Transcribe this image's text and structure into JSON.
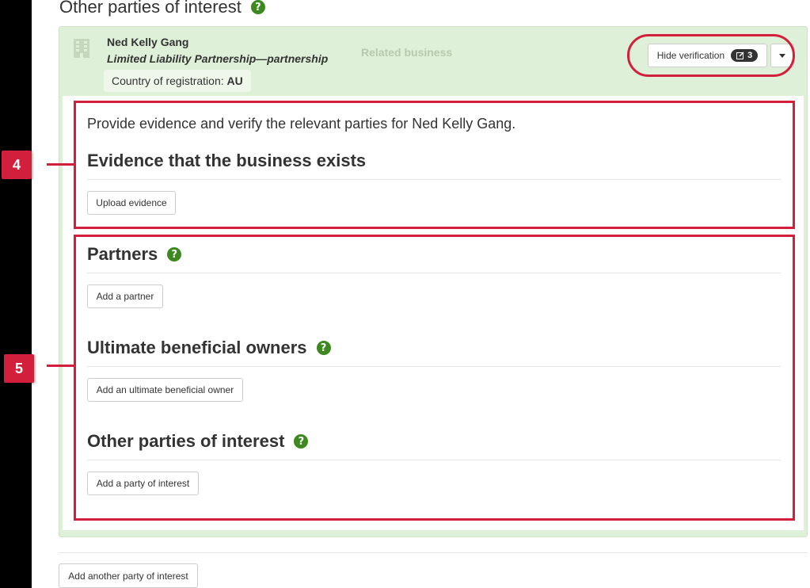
{
  "page": {
    "title": "Other parties of interest",
    "help_glyph": "?"
  },
  "party": {
    "name": "Ned Kelly Gang",
    "type": "Limited Liability Partnership—partnership",
    "country_label": "Country of registration:",
    "country_value": "AU",
    "related_label": "Related business",
    "hide_verification_label": "Hide verification",
    "verification_count": "3"
  },
  "verification": {
    "intro": "Provide evidence and verify the relevant parties for Ned Kelly Gang.",
    "evidence": {
      "title": "Evidence that the business exists",
      "button": "Upload evidence"
    },
    "partners": {
      "title": "Partners",
      "button": "Add a partner"
    },
    "ubo": {
      "title": "Ultimate beneficial owners",
      "button": "Add an ultimate beneficial owner"
    },
    "other": {
      "title": "Other parties of interest",
      "button": "Add a party of interest"
    }
  },
  "footer": {
    "add_another_label": "Add another party of interest"
  },
  "annotations": {
    "marker_4": "4",
    "marker_5": "5"
  },
  "colors": {
    "accent_green": "#3c8a1f",
    "card_bg": "#dff0d8",
    "annotation_red": "#d2203c"
  },
  "icons": [
    "help-icon",
    "building-icon",
    "edit-icon",
    "caret-down-icon"
  ]
}
